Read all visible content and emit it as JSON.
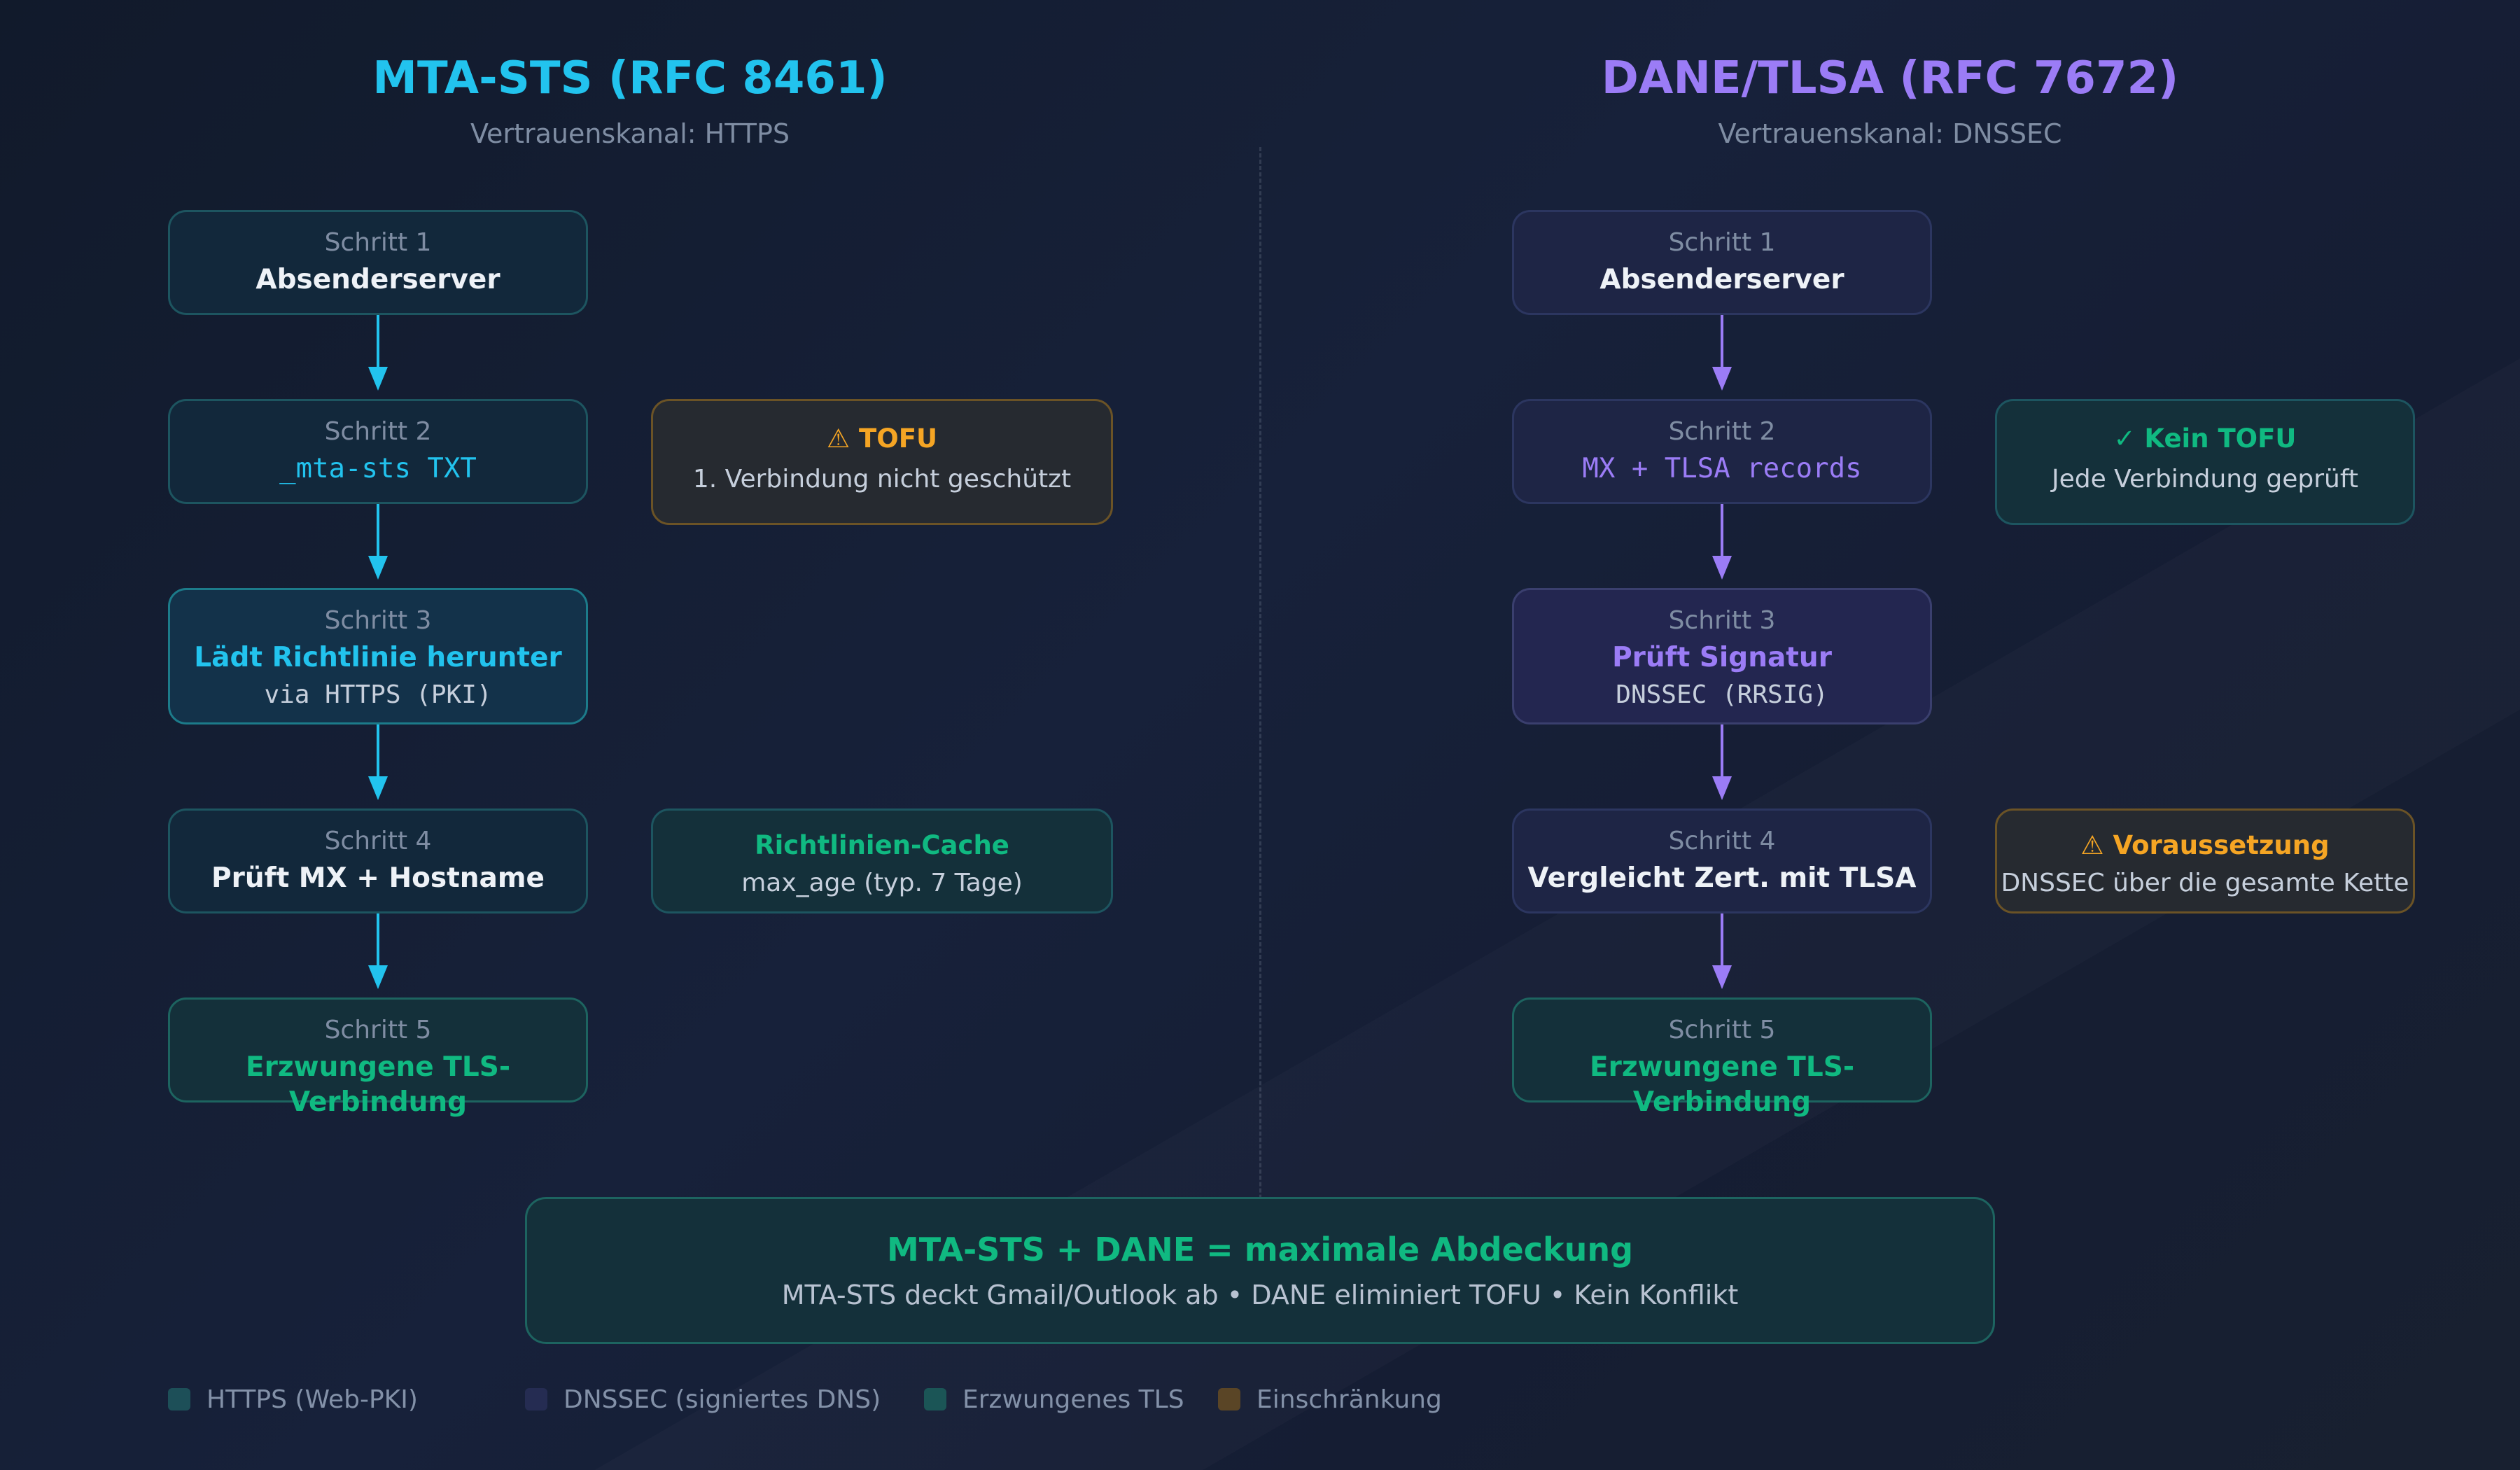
{
  "left": {
    "title": "MTA-STS (RFC 8461)",
    "subtitle": "Vertrauenskanal: HTTPS",
    "steps": [
      {
        "label": "Schritt 1",
        "main": "Absenderserver"
      },
      {
        "label": "Schritt 2",
        "main": "_mta-sts TXT"
      },
      {
        "label": "Schritt 3",
        "main": "Lädt Richtlinie herunter",
        "extra": "via HTTPS (PKI)"
      },
      {
        "label": "Schritt 4",
        "main": "Prüft MX + Hostname"
      },
      {
        "label": "Schritt 5",
        "main": "Erzwungene TLS-Verbindung"
      }
    ],
    "notes": [
      {
        "icon": "⚠",
        "title": "TOFU",
        "text": "1. Verbindung nicht geschützt"
      },
      {
        "title": "Richtlinien-Cache",
        "text": "max_age (typ. 7 Tage)"
      }
    ]
  },
  "right": {
    "title": "DANE/TLSA (RFC 7672)",
    "subtitle": "Vertrauenskanal: DNSSEC",
    "steps": [
      {
        "label": "Schritt 1",
        "main": "Absenderserver"
      },
      {
        "label": "Schritt 2",
        "main": "MX + TLSA records"
      },
      {
        "label": "Schritt 3",
        "main": "Prüft Signatur",
        "extra": "DNSSEC (RRSIG)"
      },
      {
        "label": "Schritt 4",
        "main": "Vergleicht Zert. mit TLSA"
      },
      {
        "label": "Schritt 5",
        "main": "Erzwungene TLS-Verbindung"
      }
    ],
    "notes": [
      {
        "icon": "✓",
        "title": "Kein TOFU",
        "text": "Jede Verbindung geprüft"
      },
      {
        "icon": "⚠",
        "title": "Voraussetzung",
        "text": "DNSSEC über die gesamte Kette"
      }
    ]
  },
  "summary": {
    "title": "MTA-STS + DANE = maximale Abdeckung",
    "text": "MTA-STS deckt Gmail/Outlook ab • DANE eliminiert TOFU • Kein Konflikt"
  },
  "legend": [
    {
      "label": "HTTPS (Web-PKI)",
      "color": "#1d4f58"
    },
    {
      "label": "DNSSEC (signiertes DNS)",
      "color": "#252c52"
    },
    {
      "label": "Erzwungenes TLS",
      "color": "#1b5556"
    },
    {
      "label": "Einschränkung",
      "color": "#5a4526"
    }
  ],
  "colors": {
    "mta_sts_accent": "#22c3ee",
    "dane_accent": "#9b7cf6",
    "success": "#10b981",
    "warning": "#f5a524"
  }
}
